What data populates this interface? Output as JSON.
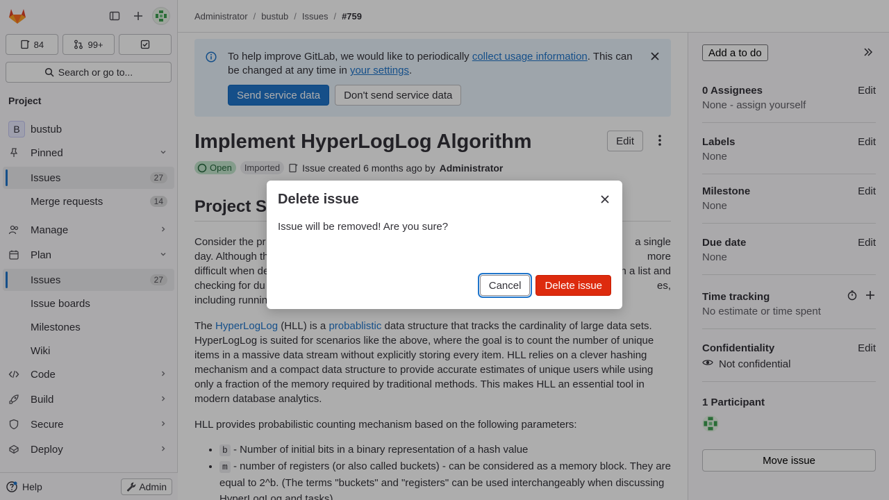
{
  "sidebar": {
    "counts": {
      "issues": "84",
      "merge_requests": "99+"
    },
    "search_label": "Search or go to...",
    "section_label": "Project",
    "project_name": "bustub",
    "project_initial": "B",
    "pinned_label": "Pinned",
    "pinned_issues_label": "Issues",
    "pinned_issues_count": "27",
    "pinned_mr_label": "Merge requests",
    "pinned_mr_count": "14",
    "manage_label": "Manage",
    "plan_label": "Plan",
    "plan_issues_label": "Issues",
    "plan_issues_count": "27",
    "issue_boards_label": "Issue boards",
    "milestones_label": "Milestones",
    "wiki_label": "Wiki",
    "code_label": "Code",
    "build_label": "Build",
    "secure_label": "Secure",
    "deploy_label": "Deploy",
    "help_label": "Help",
    "admin_label": "Admin"
  },
  "breadcrumb": {
    "items": [
      "Administrator",
      "bustub",
      "Issues"
    ],
    "current": "#759"
  },
  "alert": {
    "text_1": "To help improve GitLab, we would like to periodically ",
    "link_1": "collect usage information",
    "text_2": ". This can be changed at any time in ",
    "link_2": "your settings",
    "text_3": ".",
    "send_label": "Send service data",
    "dont_send_label": "Don't send service data"
  },
  "issue": {
    "title": "Implement HyperLogLog Algorithm",
    "edit_label": "Edit",
    "status": "Open",
    "imported": "Imported",
    "created_text": "Issue created 6 months ago by",
    "author": "Administrator",
    "section_heading": "Project S",
    "para1_lines": [
      "Consider the pr",
      "day. Although th",
      "difficult when de",
      "checking for du",
      "including runnin"
    ],
    "para1_right": [
      "a single",
      "more",
      "n a list and",
      "es,",
      ""
    ],
    "para2_pre": "The ",
    "para2_link1": "HyperLogLog",
    "para2_mid": " (HLL) is a ",
    "para2_link2": "probablistic",
    "para2_rest": " data structure that tracks the cardinality of large data sets. HyperLogLog is suited for scenarios like the above, where the goal is to count the number of unique items in a massive data stream without explicitly storing every item. HLL relies on a clever hashing mechanism and a compact data structure to provide accurate estimates of unique users while using only a fraction of the memory required by traditional methods. This makes HLL an essential tool in modern database analytics.",
    "para3": "HLL provides probabilistic counting mechanism based on the following parameters:",
    "list": [
      {
        "code": "b",
        "text": " - Number of initial bits in a binary representation of a hash value"
      },
      {
        "code": "m",
        "text": " - number of registers (or also called buckets) - can be considered as a memory block. They are equal to 2^b. (The terms \"buckets\" and \"registers\" can be used interchangeably when discussing HyperLogLog and tasks)"
      }
    ]
  },
  "right_sidebar": {
    "todo_label": "Add a to do",
    "edit_label": "Edit",
    "assignees_label": "0 Assignees",
    "assignees_value": "None - assign yourself",
    "labels_label": "Labels",
    "labels_value": "None",
    "milestone_label": "Milestone",
    "milestone_value": "None",
    "due_label": "Due date",
    "due_value": "None",
    "time_label": "Time tracking",
    "time_value": "No estimate or time spent",
    "conf_label": "Confidentiality",
    "conf_value": "Not confidential",
    "participants_label": "1 Participant",
    "move_label": "Move issue"
  },
  "modal": {
    "title": "Delete issue",
    "body": "Issue will be removed! Are you sure?",
    "cancel_label": "Cancel",
    "delete_label": "Delete issue"
  },
  "colors": {
    "primary": "#1f75cb",
    "danger": "#dd2b0e",
    "success_bg": "#c3e6cd"
  }
}
